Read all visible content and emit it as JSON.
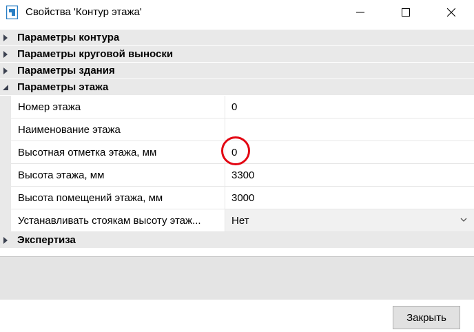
{
  "window": {
    "title": "Свойства 'Контур этажа'",
    "app_icon": "floor-plan-app-icon",
    "controls": [
      "minimize-icon",
      "maximize-icon",
      "close-icon"
    ]
  },
  "categories": {
    "contour": {
      "label": "Параметры контура",
      "expanded": false
    },
    "callout": {
      "label": "Параметры круговой выноски",
      "expanded": false
    },
    "building": {
      "label": "Параметры здания",
      "expanded": false
    },
    "floor": {
      "label": "Параметры этажа",
      "expanded": true
    },
    "expertise": {
      "label": "Экспертиза",
      "expanded": false
    }
  },
  "floor_properties": [
    {
      "name": "Номер этажа",
      "value": "0"
    },
    {
      "name": "Наименование этажа",
      "value": ""
    },
    {
      "name": "Высотная отметка этажа, мм",
      "value": "0"
    },
    {
      "name": "Высота этажа, мм",
      "value": "3300"
    },
    {
      "name": "Высота помещений этажа, мм",
      "value": "3000"
    },
    {
      "name": "Устанавливать стоякам высоту этаж...",
      "value": "Нет",
      "type": "dropdown"
    }
  ],
  "footer": {
    "close_label": "Закрыть"
  },
  "colors": {
    "highlight_circle": "#e30613",
    "category_bg": "#e9e9e9",
    "arrow": "#3b4150"
  }
}
